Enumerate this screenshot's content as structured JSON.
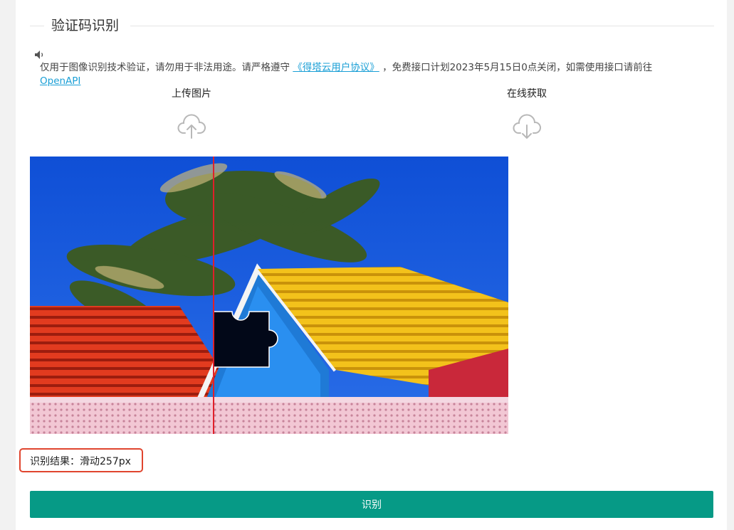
{
  "section": {
    "title": "验证码识别"
  },
  "notice": {
    "text_before": "仅用于图像识别技术验证，请勿用于非法用途。请严格遵守",
    "agreement_link": "《得塔云用户协议》",
    "text_after": "，免费接口计划2023年5月15日0点关闭，如需使用接口请前往",
    "openapi_link": "OpenAPI"
  },
  "actions": {
    "upload_label": "上传图片",
    "fetch_label": "在线获取"
  },
  "icons": {
    "sound": "speaker-icon",
    "upload": "cloud-upload-icon",
    "fetch": "cloud-download-icon"
  },
  "result": {
    "label": "识别结果：",
    "value": "滑动257px"
  },
  "button": {
    "recognize_label": "识别"
  },
  "colors": {
    "accent": "#069a86",
    "link": "#1a9fd6",
    "highlight_border": "#e0452e",
    "marker_line": "#e0202a"
  }
}
